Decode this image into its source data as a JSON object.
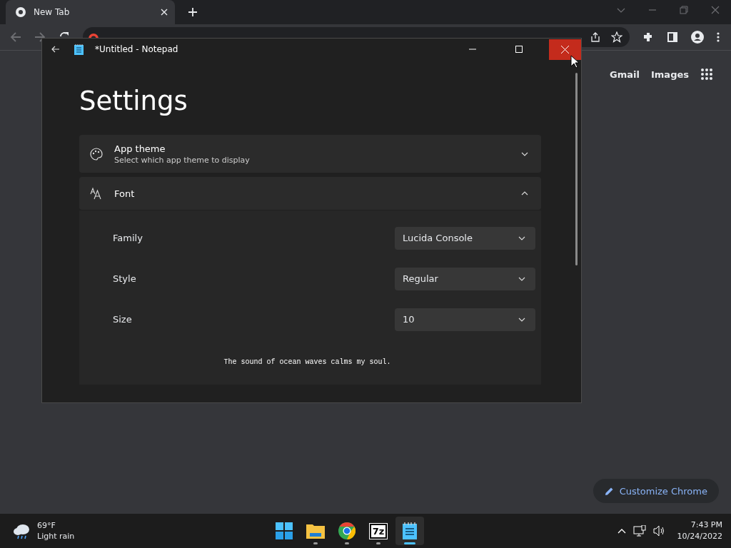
{
  "browser": {
    "tabs": [
      {
        "title": "New Tab",
        "selected": true
      }
    ],
    "links": [
      "Gmail",
      "Images"
    ],
    "customize_button": "Customize Chrome"
  },
  "notepad": {
    "title": "*Untitled - Notepad",
    "heading": "Settings",
    "sections": [
      {
        "kind": "theme",
        "title": "App theme",
        "subtitle": "Select which app theme to display",
        "expanded": false
      },
      {
        "kind": "font",
        "title": "Font",
        "expanded": true,
        "fields": [
          {
            "label": "Family",
            "value": "Lucida Console"
          },
          {
            "label": "Style",
            "value": "Regular"
          },
          {
            "label": "Size",
            "value": "10"
          }
        ],
        "preview": "The sound of ocean waves calms my soul."
      }
    ]
  },
  "taskbar": {
    "weather": {
      "temperature": "69°F",
      "condition": "Light rain"
    },
    "apps": [
      {
        "kind": "start",
        "running": false,
        "selected": false
      },
      {
        "kind": "folder",
        "running": true,
        "selected": false
      },
      {
        "kind": "chrome",
        "running": true,
        "selected": false
      },
      {
        "kind": "archive",
        "label": "7z",
        "running": true,
        "selected": false
      },
      {
        "kind": "notepad",
        "running": true,
        "selected": true
      }
    ],
    "time": "7:43 PM",
    "date": "10/24/2022"
  }
}
